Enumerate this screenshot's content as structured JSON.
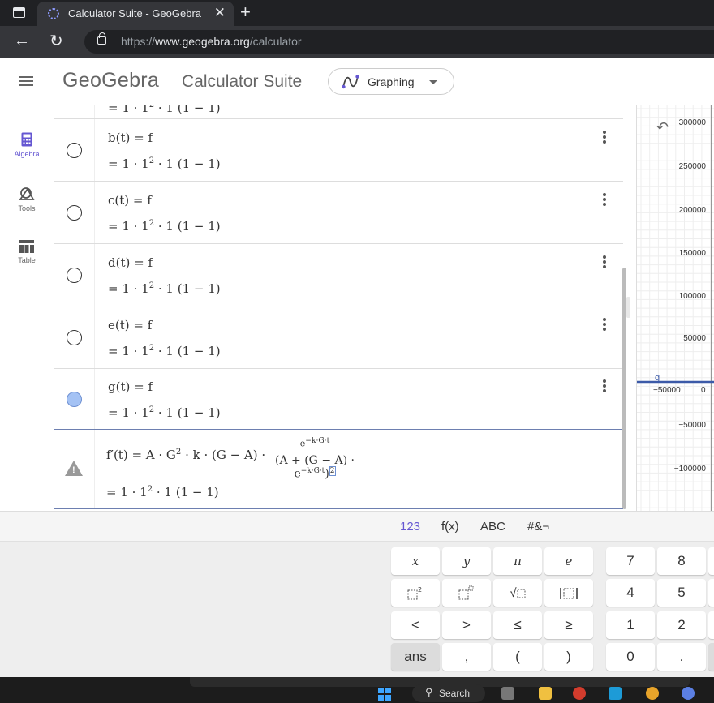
{
  "browser": {
    "tab_title": "Calculator Suite - GeoGebra",
    "tab_close": "✕",
    "new_tab": "+",
    "url_prefix": "https://",
    "url_host": "www.geogebra.org",
    "url_path": "/calculator"
  },
  "header": {
    "logo": "GeoGebra",
    "suite_title": "Calculator Suite",
    "app_switch_label": "Graphing"
  },
  "rail": [
    {
      "label": "Algebra",
      "icon": "calculator-icon",
      "active": true
    },
    {
      "label": "Tools",
      "icon": "tools-icon",
      "active": false
    },
    {
      "label": "Table",
      "icon": "table-icon",
      "active": false
    }
  ],
  "algebra": {
    "value": "= 1 · 1",
    "value_sup": "2",
    "value_tail": " · 1 (1 − 1)",
    "rows": [
      {
        "def": "b(t) = f"
      },
      {
        "def": "c(t) = f"
      },
      {
        "def": "d(t) = f"
      },
      {
        "def": "e(t) = f"
      },
      {
        "def": "g(t) = f"
      }
    ],
    "deriv_lhs": "f′(t) = A · G",
    "deriv_sup": "2",
    "deriv_mid": " · k · (G − A) ·",
    "frac_num": "e",
    "frac_num_sup": "−k·G·t",
    "frac_den": "(A + (G − A) · e",
    "frac_den_sup": "−k·G·t",
    "frac_den_close": ")",
    "frac_den_pow": "2"
  },
  "graph": {
    "yticks": [
      "300000",
      "250000",
      "200000",
      "150000",
      "100000",
      "50000",
      "−50000",
      "−100000"
    ],
    "x_tick_left": "−50000",
    "x_tick_zero": "0",
    "object_label": "g"
  },
  "keyboard": {
    "tabs": [
      "123",
      "f(x)",
      "ABC",
      "#&¬"
    ],
    "active_tab": "123",
    "keys": {
      "x": "x",
      "y": "y",
      "pi": "π",
      "e": "e",
      "seven": "7",
      "eight": "8",
      "four": "4",
      "five": "5",
      "one": "1",
      "two": "2",
      "zero": "0",
      "dot": ".",
      "lt": "<",
      "gt": ">",
      "le": "≤",
      "ge": "≥",
      "ans": "ans",
      "comma": ",",
      "lparen": "(",
      "rparen": ")",
      "sqrt": "√"
    }
  },
  "taskbar": {
    "search_label": "Search"
  },
  "colors": {
    "accent": "#6557d2",
    "g_curve": "#3c5aa8",
    "radio_fill": "#a4c2f4"
  }
}
